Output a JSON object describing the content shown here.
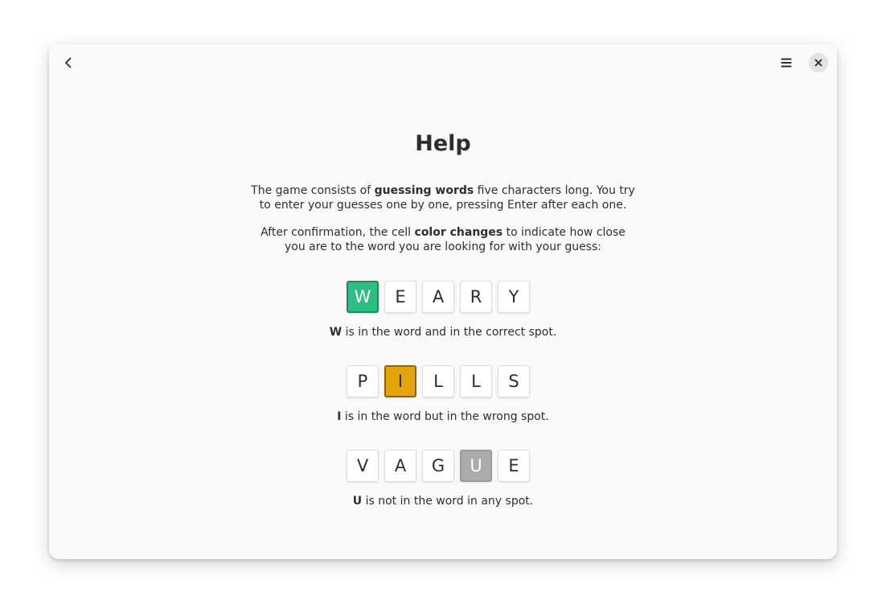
{
  "headerbar": {
    "back_icon": "go-previous-icon",
    "menu_icon": "hamburger-menu-icon",
    "close_icon": "close-icon"
  },
  "help": {
    "title": "Help",
    "para1": {
      "pre": "The game consists of ",
      "bold": "guessing words",
      "post": " five characters long. You try to enter your guesses one by one, pressing Enter after each one."
    },
    "para2": {
      "pre": "After confirmation, the cell ",
      "bold": "color changes",
      "post": " to indicate how close you are to the word you are looking for with your guess:"
    }
  },
  "colors": {
    "correct": "#2ebd83",
    "present": "#e5a50a",
    "absent": "#ababab"
  },
  "examples": [
    {
      "letters": [
        "W",
        "E",
        "A",
        "R",
        "Y"
      ],
      "states": [
        "correct",
        "empty",
        "empty",
        "empty",
        "empty"
      ],
      "caption_letter": "W",
      "caption_text": " is in the word and in the correct spot."
    },
    {
      "letters": [
        "P",
        "I",
        "L",
        "L",
        "S"
      ],
      "states": [
        "empty",
        "present",
        "empty",
        "empty",
        "empty"
      ],
      "caption_letter": "I",
      "caption_text": " is in the word but in the wrong spot."
    },
    {
      "letters": [
        "V",
        "A",
        "G",
        "U",
        "E"
      ],
      "states": [
        "empty",
        "empty",
        "empty",
        "absent",
        "empty"
      ],
      "caption_letter": "U",
      "caption_text": " is not in the word in any spot."
    }
  ]
}
